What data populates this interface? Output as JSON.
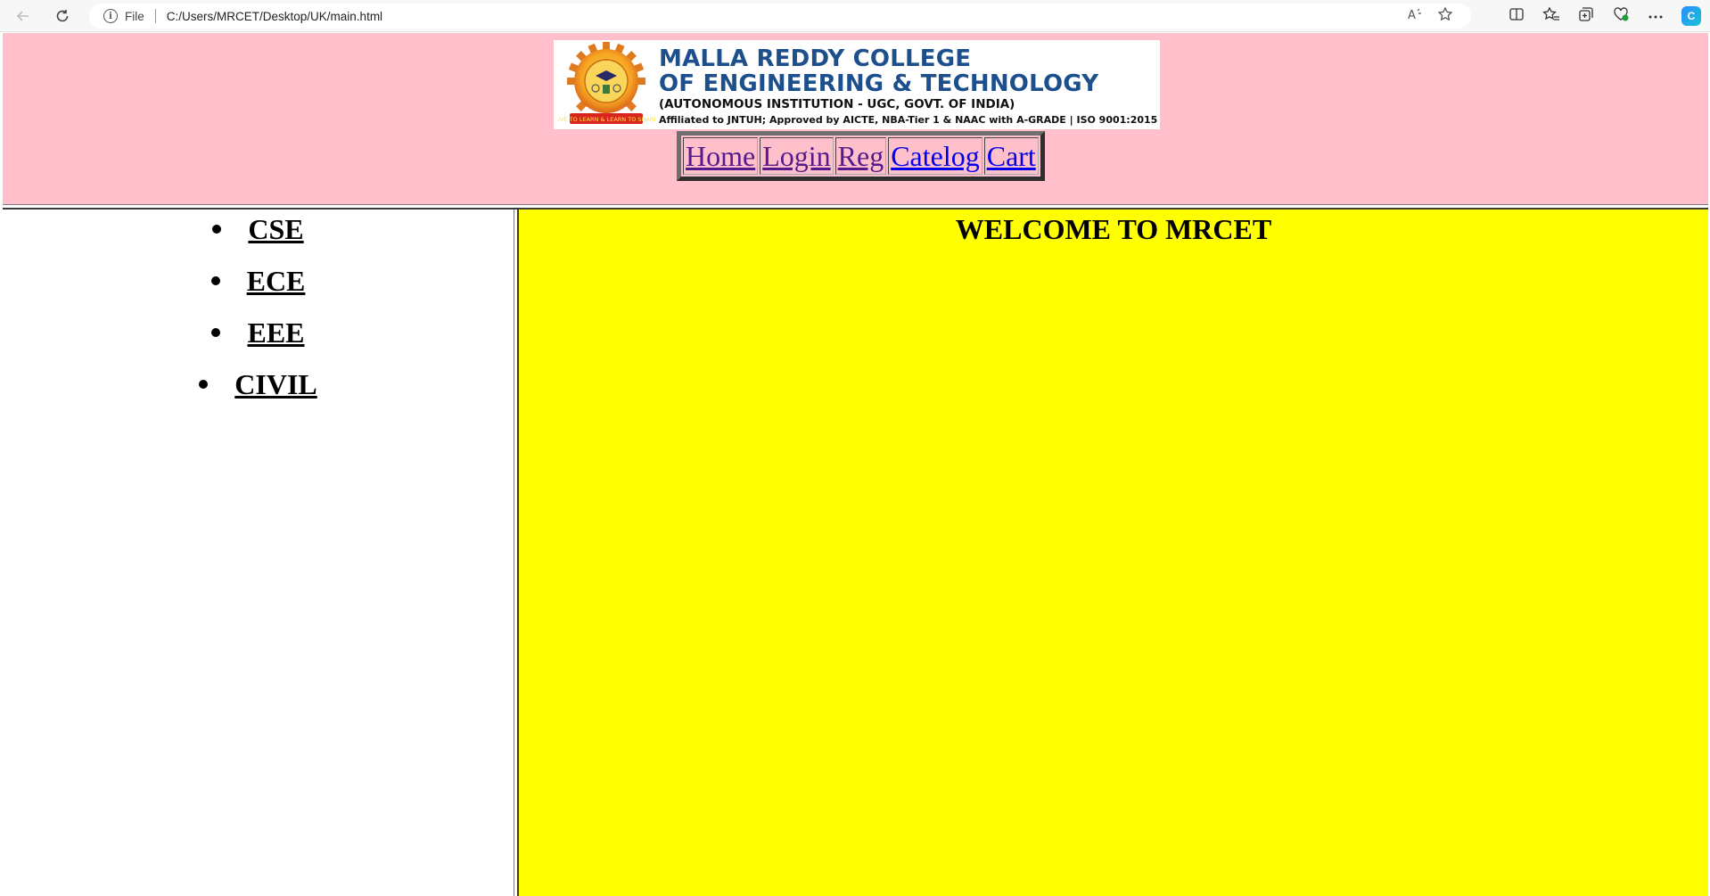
{
  "browser": {
    "scheme_label": "File",
    "url": "C:/Users/MRCET/Desktop/UK/main.html"
  },
  "logo": {
    "line1": "MALLA REDDY COLLEGE",
    "line2": "OF ENGINEERING & TECHNOLOGY",
    "line3": "(AUTONOMOUS INSTITUTION - UGC, GOVT. OF INDIA)",
    "line4": "Affiliated to JNTUH; Approved by AICTE, NBA-Tier 1 & NAAC with A-GRADE | ISO 9001:2015",
    "motto": "LIVE TO LEARN & LEARN TO SHARE"
  },
  "menu": [
    {
      "label": "Home"
    },
    {
      "label": "Login"
    },
    {
      "label": "Reg"
    },
    {
      "label": "Catelog"
    },
    {
      "label": "Cart"
    }
  ],
  "departments": [
    {
      "label": "CSE"
    },
    {
      "label": "ECE"
    },
    {
      "label": "EEE"
    },
    {
      "label": "CIVIL"
    }
  ],
  "main": {
    "heading": "WELCOME TO MRCET"
  },
  "colors": {
    "header_bg": "#ffc0cb",
    "main_bg": "#ffff00",
    "left_bg": "#ffffff",
    "logo_blue": "#1c4f8c",
    "visited_link": "#551a8b",
    "unvisited_link": "#0000ee"
  },
  "icons": {
    "back": "arrow-left-icon",
    "refresh": "refresh-icon",
    "info": "info-icon",
    "read_aloud": "read-aloud-icon",
    "favorite": "star-icon",
    "split": "split-screen-icon",
    "favorites": "favorites-icon",
    "collections": "collections-icon",
    "performance": "browser-essentials-icon",
    "more": "more-icon",
    "copilot": "copilot-icon"
  }
}
